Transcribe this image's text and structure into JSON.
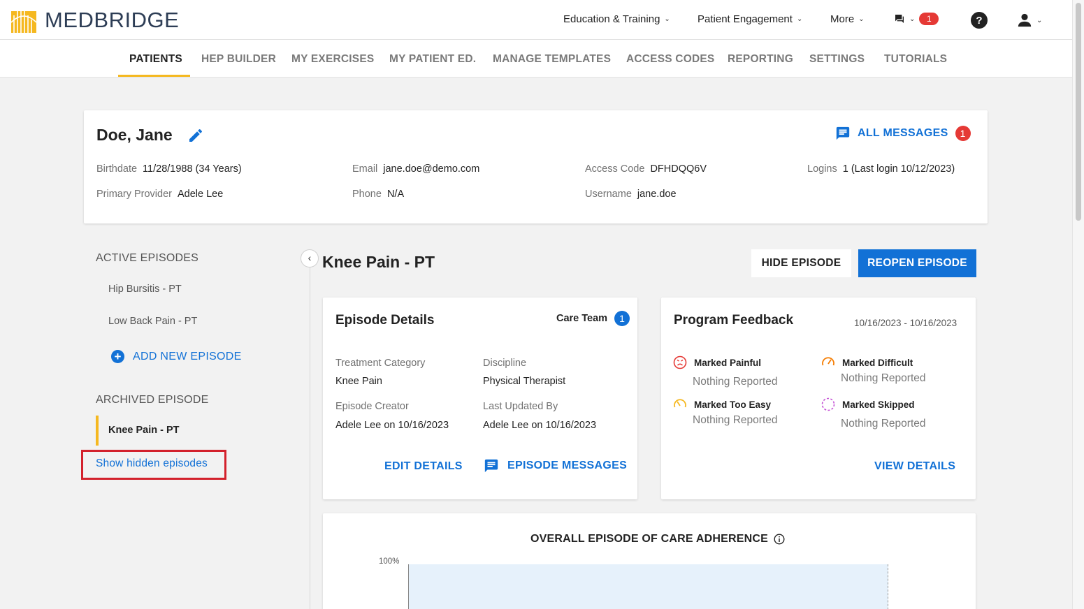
{
  "brand": {
    "name": "MEDBRIDGE",
    "accent": "#f5b820",
    "primary": "#1271d6"
  },
  "topnav": {
    "education": "Education & Training",
    "engagement": "Patient Engagement",
    "more": "More",
    "messages_count": "1",
    "icons": [
      "chat-icon",
      "help-icon",
      "user-icon"
    ]
  },
  "subnav": {
    "tabs": [
      "PATIENTS",
      "HEP BUILDER",
      "MY EXERCISES",
      "MY PATIENT ED.",
      "MANAGE TEMPLATES",
      "ACCESS CODES",
      "REPORTING",
      "SETTINGS",
      "TUTORIALS"
    ],
    "active": "PATIENTS"
  },
  "patient": {
    "name": "Doe, Jane",
    "all_messages_label": "ALL MESSAGES",
    "all_messages_count": "1",
    "birthdate_label": "Birthdate",
    "birthdate": "11/28/1988 (34 Years)",
    "provider_label": "Primary Provider",
    "provider": "Adele Lee",
    "email_label": "Email",
    "email": "jane.doe@demo.com",
    "phone_label": "Phone",
    "phone": "N/A",
    "access_code_label": "Access Code",
    "access_code": "DFHDQQ6V",
    "username_label": "Username",
    "username": "jane.doe",
    "logins_label": "Logins",
    "logins": "1 (Last login 10/12/2023)"
  },
  "sidebar": {
    "active_heading": "ACTIVE EPISODES",
    "active_episodes": [
      "Hip Bursitis - PT",
      "Low Back Pain - PT"
    ],
    "add_episode": "ADD NEW EPISODE",
    "archived_heading": "ARCHIVED EPISODE",
    "archived_episode": "Knee Pain - PT",
    "show_hidden": "Show hidden episodes"
  },
  "episode": {
    "title": "Knee Pain - PT",
    "hide_button": "HIDE EPISODE",
    "reopen_button": "REOPEN EPISODE"
  },
  "details": {
    "title": "Episode Details",
    "care_team_label": "Care Team",
    "care_team_count": "1",
    "treatment_category_label": "Treatment Category",
    "treatment_category": "Knee Pain",
    "discipline_label": "Discipline",
    "discipline": "Physical Therapist",
    "creator_label": "Episode Creator",
    "creator": "Adele Lee on 10/16/2023",
    "updated_label": "Last Updated By",
    "updated": "Adele Lee on 10/16/2023",
    "edit_details": "EDIT DETAILS",
    "episode_messages": "EPISODE MESSAGES"
  },
  "feedback": {
    "title": "Program Feedback",
    "date_range": "10/16/2023 - 10/16/2023",
    "painful_label": "Marked Painful",
    "painful_value": "Nothing Reported",
    "difficult_label": "Marked Difficult",
    "difficult_value": "Nothing Reported",
    "easy_label": "Marked Too Easy",
    "easy_value": "Nothing Reported",
    "skipped_label": "Marked Skipped",
    "skipped_value": "Nothing Reported",
    "view_details": "VIEW DETAILS",
    "colors": {
      "painful": "#e53935",
      "difficult": "#f57c00",
      "easy": "#f5b820",
      "skipped": "#c34fd4"
    }
  },
  "adherence": {
    "title": "OVERALL EPISODE OF CARE ADHERENCE",
    "y_tick_top": "100%"
  }
}
